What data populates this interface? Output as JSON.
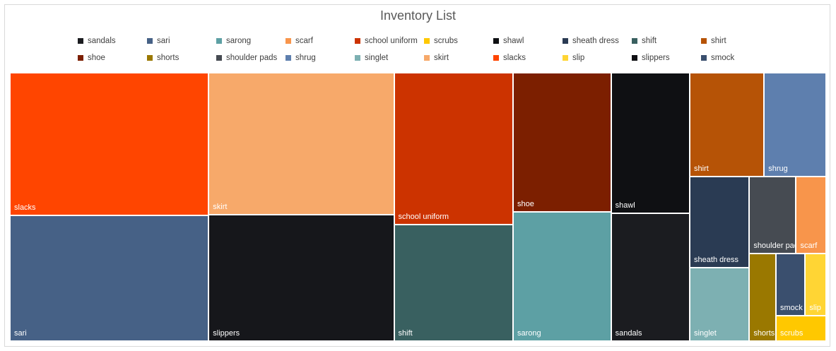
{
  "chart_data": {
    "type": "treemap",
    "title": "Inventory List",
    "legend_position": "top",
    "items": [
      {
        "name": "slacks",
        "color": "#FF4500",
        "value": 11.0
      },
      {
        "name": "sari",
        "color": "#466186",
        "value": 9.7
      },
      {
        "name": "skirt",
        "color": "#F7A96A",
        "value": 10.2
      },
      {
        "name": "slippers",
        "color": "#16171B",
        "value": 9.1
      },
      {
        "name": "school uniform",
        "color": "#CC3300",
        "value": 7.0
      },
      {
        "name": "shift",
        "color": "#396060",
        "value": 5.4
      },
      {
        "name": "shoe",
        "color": "#7C1F00",
        "value": 5.3
      },
      {
        "name": "sarong",
        "color": "#5DA0A4",
        "value": 4.9
      },
      {
        "name": "shawl",
        "color": "#0F1013",
        "value": 4.3
      },
      {
        "name": "sandals",
        "color": "#1B1C20",
        "value": 3.9
      },
      {
        "name": "shirt",
        "color": "#B65306",
        "value": 3.0
      },
      {
        "name": "shrug",
        "color": "#5E7FAE",
        "value": 2.5
      },
      {
        "name": "sheath dress",
        "color": "#2A3B53",
        "value": 2.1
      },
      {
        "name": "singlet",
        "color": "#7DB0B2",
        "value": 1.7
      },
      {
        "name": "shoulder pads",
        "color": "#464B52",
        "value": 1.4
      },
      {
        "name": "scarf",
        "color": "#F8954B",
        "value": 0.9
      },
      {
        "name": "shorts",
        "color": "#9A7800",
        "value": 0.9
      },
      {
        "name": "smock",
        "color": "#3A4F6E",
        "value": 0.7
      },
      {
        "name": "slip",
        "color": "#FFD534",
        "value": 0.5
      },
      {
        "name": "scrubs",
        "color": "#FFC800",
        "value": 0.5
      }
    ],
    "legend": [
      {
        "name": "sandals",
        "color": "#1B1C20"
      },
      {
        "name": "sari",
        "color": "#466186"
      },
      {
        "name": "sarong",
        "color": "#5DA0A4"
      },
      {
        "name": "scarf",
        "color": "#F8954B"
      },
      {
        "name": "school uniform",
        "color": "#CC3300"
      },
      {
        "name": "scrubs",
        "color": "#FFC800"
      },
      {
        "name": "shawl",
        "color": "#0F1013"
      },
      {
        "name": "sheath dress",
        "color": "#2A3B53"
      },
      {
        "name": "shift",
        "color": "#396060"
      },
      {
        "name": "shirt",
        "color": "#B65306"
      },
      {
        "name": "shoe",
        "color": "#7C1F00"
      },
      {
        "name": "shorts",
        "color": "#9A7800"
      },
      {
        "name": "shoulder pads",
        "color": "#464B52"
      },
      {
        "name": "shrug",
        "color": "#5E7FAE"
      },
      {
        "name": "singlet",
        "color": "#7DB0B2"
      },
      {
        "name": "skirt",
        "color": "#F7A96A"
      },
      {
        "name": "slacks",
        "color": "#FF4500"
      },
      {
        "name": "slip",
        "color": "#FFD534"
      },
      {
        "name": "slippers",
        "color": "#0F1013"
      },
      {
        "name": "smock",
        "color": "#3A4F6E"
      }
    ]
  }
}
